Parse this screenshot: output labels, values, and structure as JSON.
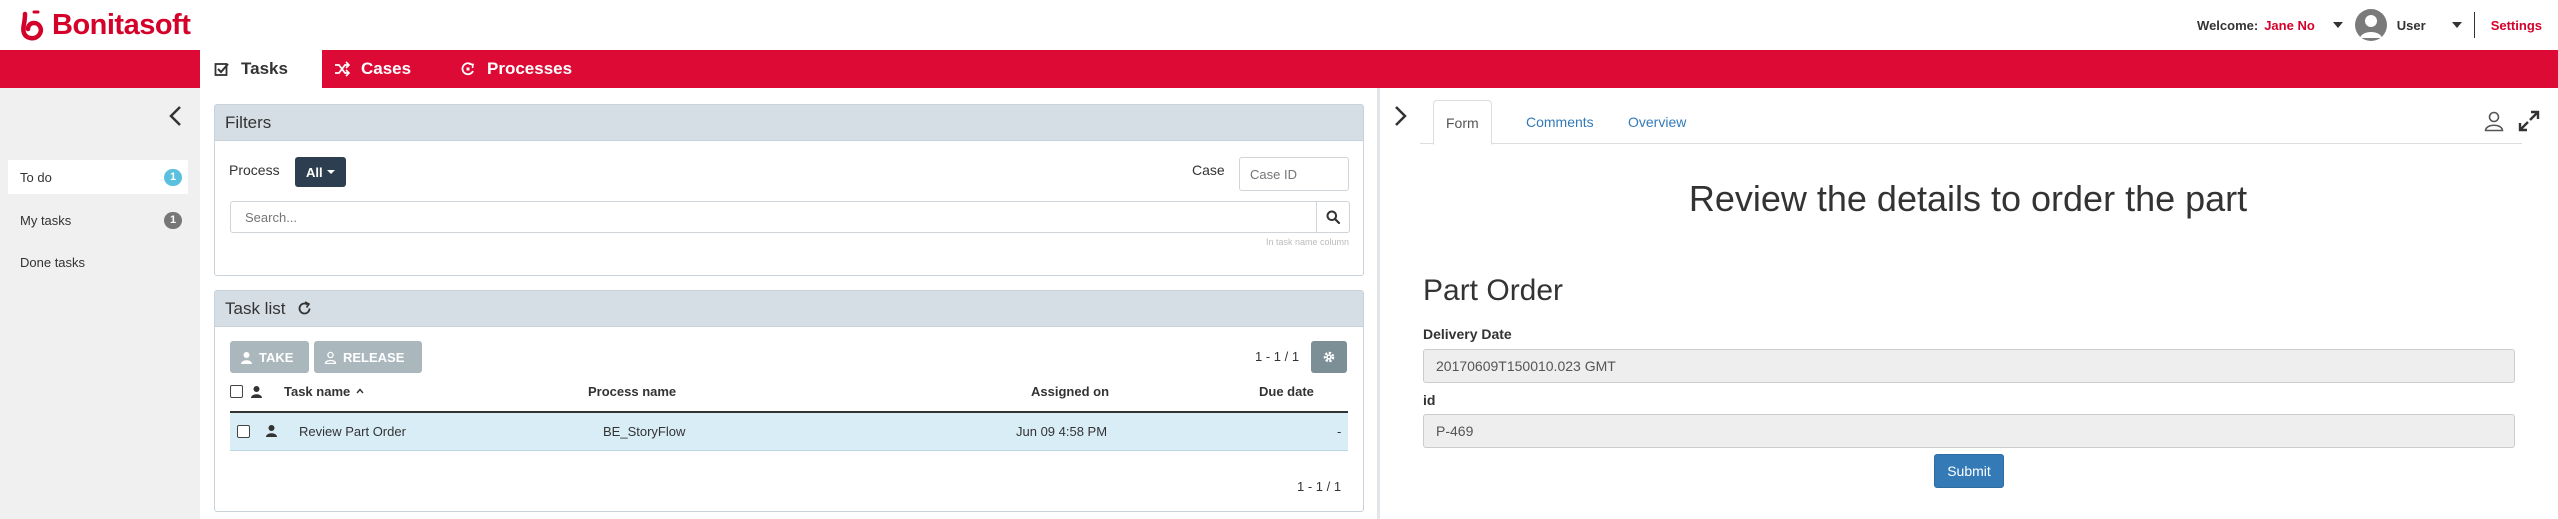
{
  "header": {
    "brand": "Bonitasoft",
    "welcome_label": "Welcome:",
    "user_name": "Jane No",
    "role": "User",
    "settings_label": "Settings",
    "brand_color": "#d4022a"
  },
  "nav": {
    "tasks": "Tasks",
    "cases": "Cases",
    "processes": "Processes",
    "active": "Tasks",
    "bar_color": "#dc0a35"
  },
  "sidebar": {
    "items": [
      {
        "label": "To do",
        "count": "1",
        "active": true,
        "badge_color": "#5bc0de"
      },
      {
        "label": "My tasks",
        "count": "1",
        "active": false,
        "badge_color": "#777777"
      },
      {
        "label": "Done tasks",
        "count": "",
        "active": false
      }
    ]
  },
  "filters": {
    "title": "Filters",
    "process_label": "Process",
    "process_value": "All",
    "case_label": "Case",
    "case_placeholder": "Case ID",
    "search_placeholder": "Search...",
    "search_hint": "In task name column"
  },
  "tasklist": {
    "title": "Task list",
    "take_label": "TAKE",
    "release_label": "RELEASE",
    "pager_top": "1 - 1 / 1",
    "pager_bottom": "1 - 1 / 1",
    "columns": [
      "Task name",
      "Process name",
      "Assigned on",
      "Due date"
    ],
    "sort_indicator": "^",
    "rows": [
      {
        "task_name": "Review Part Order",
        "process_name": "BE_StoryFlow",
        "assigned_on": "Jun 09 4:58 PM",
        "due_date": "-"
      }
    ]
  },
  "detail": {
    "tabs": [
      "Form",
      "Comments",
      "Overview"
    ],
    "active_tab": "Form",
    "form_title": "Review the details to order the part",
    "section_title": "Part Order",
    "fields": [
      {
        "label": "Delivery Date",
        "value": "20170609T150010.023 GMT"
      },
      {
        "label": "id",
        "value": "P-469"
      }
    ],
    "submit_label": "Submit"
  }
}
